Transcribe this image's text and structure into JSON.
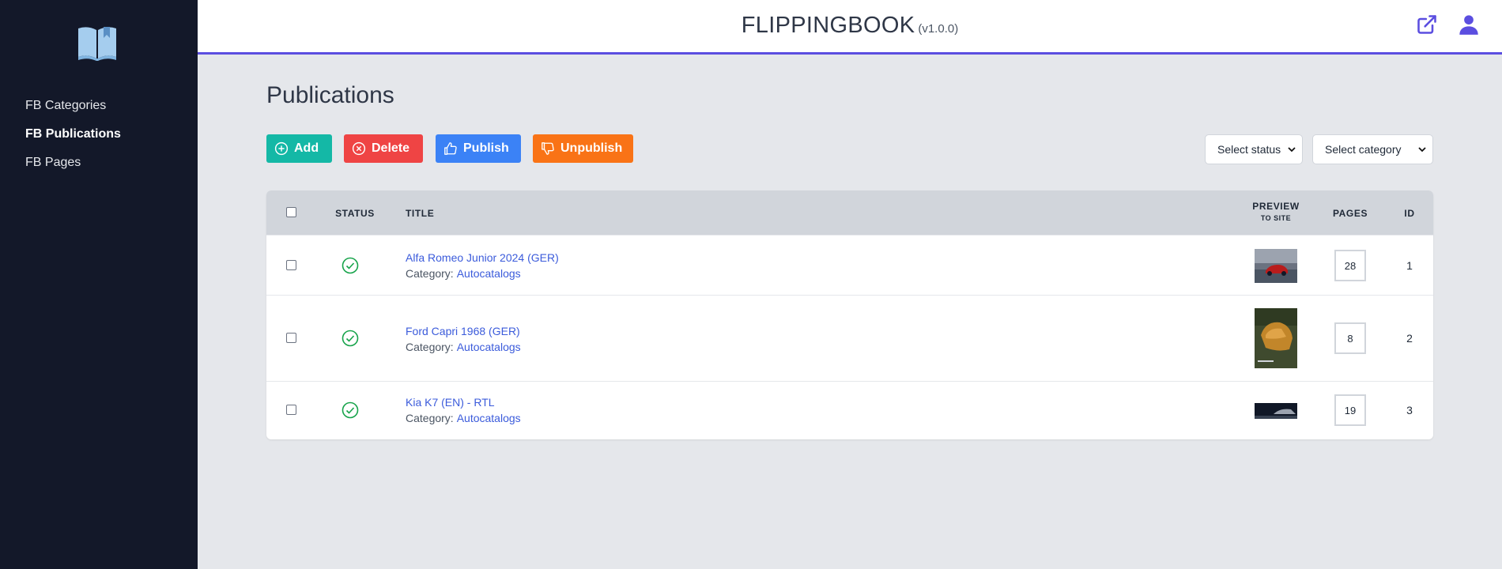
{
  "sidebar": {
    "logo_icon": "open-book-icon",
    "items": [
      {
        "label": "FB Categories",
        "active": false
      },
      {
        "label": "FB Publications",
        "active": true
      },
      {
        "label": "FB Pages",
        "active": false
      }
    ]
  },
  "header": {
    "title": "FLIPPINGBOOK",
    "version": "(v1.0.0)",
    "icons": [
      "external-link-icon",
      "user-icon"
    ],
    "accent_color": "#5b4ee0"
  },
  "main": {
    "page_title": "Publications",
    "buttons": {
      "add": "Add",
      "delete": "Delete",
      "publish": "Publish",
      "unpublish": "Unpublish"
    },
    "filters": {
      "status": "Select status",
      "category": "Select category"
    },
    "table": {
      "columns": {
        "status": "STATUS",
        "title": "TITLE",
        "preview": "PREVIEW",
        "preview_sub": "TO SITE",
        "pages": "PAGES",
        "id": "ID"
      },
      "category_label": "Category:",
      "rows": [
        {
          "title": "Alfa Romeo Junior 2024 (GER)",
          "category": "Autocatalogs",
          "pages": "28",
          "id": "1",
          "status": "published"
        },
        {
          "title": "Ford Capri 1968 (GER)",
          "category": "Autocatalogs",
          "pages": "8",
          "id": "2",
          "status": "published"
        },
        {
          "title": "Kia K7 (EN) - RTL",
          "category": "Autocatalogs",
          "pages": "19",
          "id": "3",
          "status": "published"
        }
      ]
    }
  }
}
